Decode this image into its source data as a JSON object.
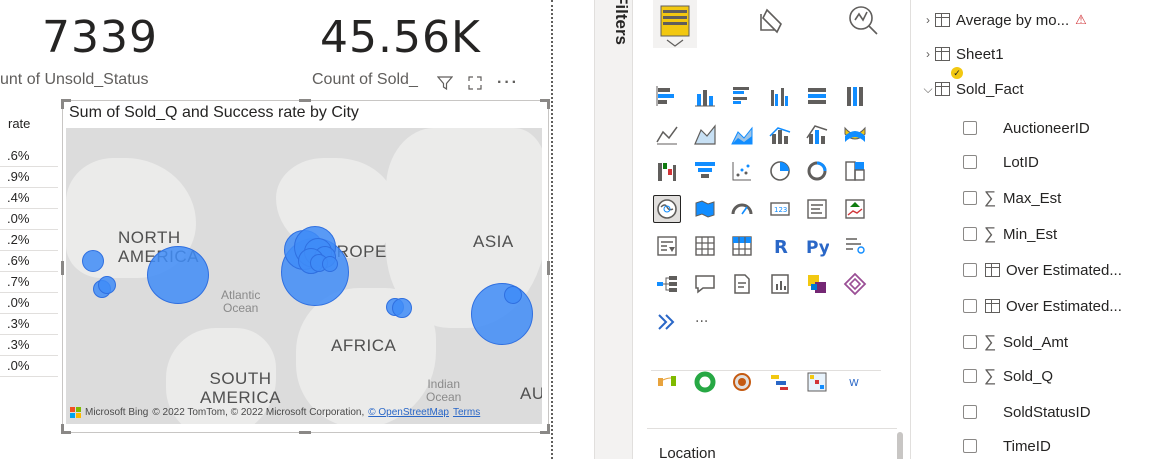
{
  "kpis": [
    {
      "value": "7339",
      "label": "unt of Unsold_Status"
    },
    {
      "value": "45.56K",
      "label": "Count of Sold_"
    }
  ],
  "rate_table": {
    "header": "rate",
    "rows": [
      ".6%",
      ".9%",
      ".4%",
      ".0%",
      ".2%",
      ".6%",
      ".7%",
      ".0%",
      ".3%",
      ".3%",
      ".0%"
    ]
  },
  "map_visual": {
    "title": "Sum of Sold_Q and Success rate by City",
    "labels": {
      "north_america": "NORTH\nAMERICA",
      "europe": "EUROPE",
      "asia": "ASIA",
      "africa": "AFRICA",
      "south_america": "SOUTH\nAMERICA",
      "atlantic": "Atlantic\nOcean",
      "indian": "Indian\nOcean",
      "australia": "AU"
    },
    "attribution": {
      "brand": "Microsoft Bing",
      "text": "© 2022 TomTom, © 2022 Microsoft Corporation,",
      "osm": "© OpenStreetMap",
      "terms": "Terms"
    },
    "bubble_color": "#408cf7"
  },
  "visualizations_pane": {
    "filters_label": "Filters",
    "more_label": "···",
    "r_label": "R",
    "py_label": "Py",
    "w_label": "W",
    "location_label": "Location"
  },
  "fields_pane": {
    "items": [
      {
        "kind": "table",
        "label": "Average by mo...",
        "warn": "⚠",
        "expanded": false
      },
      {
        "kind": "table",
        "label": "Sheet1",
        "expanded": false
      },
      {
        "kind": "table",
        "label": "Sold_Fact",
        "expanded": true
      },
      {
        "kind": "field",
        "label": "AuctioneerID"
      },
      {
        "kind": "field",
        "label": "LotID"
      },
      {
        "kind": "sum",
        "label": "Max_Est"
      },
      {
        "kind": "sum",
        "label": "Min_Est"
      },
      {
        "kind": "measure",
        "label": "Over Estimated..."
      },
      {
        "kind": "measure",
        "label": "Over Estimated..."
      },
      {
        "kind": "sum",
        "label": "Sold_Amt"
      },
      {
        "kind": "sum",
        "label": "Sold_Q"
      },
      {
        "kind": "field",
        "label": "SoldStatusID"
      },
      {
        "kind": "field",
        "label": "TimeID"
      }
    ]
  },
  "colors": {
    "accent_yellow": "#f2c811",
    "chart_blue": "#118dff",
    "warning": "#d13438"
  }
}
